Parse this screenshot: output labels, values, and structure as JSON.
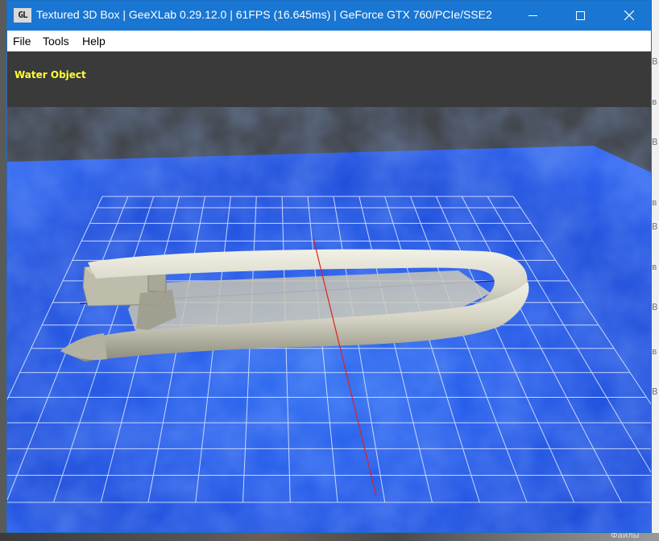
{
  "window": {
    "title": "Textured 3D Box | GeeXLab 0.29.12.0 | 61FPS (16.645ms) | GeForce GTX 760/PCIe/SSE2",
    "icon_text": "GL"
  },
  "menubar": {
    "items": [
      {
        "label": "File"
      },
      {
        "label": "Tools"
      },
      {
        "label": "Help"
      }
    ]
  },
  "viewport": {
    "overlay_label": "Water Object",
    "colors": {
      "background": "#3a3a3a",
      "water": "#1f55e8",
      "grid": "#d8e4ff",
      "boat": "#d4d2c2",
      "axis_red": "#e02020",
      "axis_blue": "#1010a0"
    }
  },
  "background_text": {
    "bottom_right": "Файлы"
  },
  "icons": [
    "app-icon",
    "minimize-icon",
    "maximize-icon",
    "close-icon"
  ]
}
